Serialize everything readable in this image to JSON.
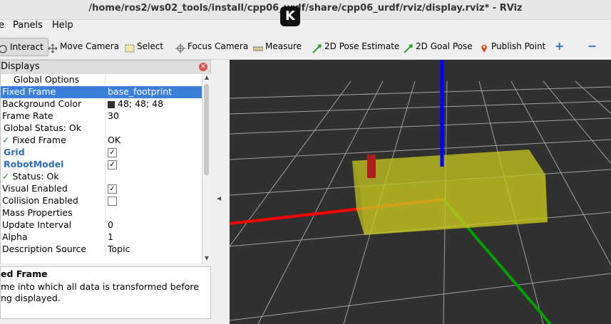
{
  "window": {
    "title": "/home/ros2/ws02_tools/install/cpp06_urdf/share/cpp06_urdf/rviz/display.rviz* - RViz"
  },
  "overlay_logo": "K",
  "menu": {
    "items": [
      "e",
      "Panels",
      "Help"
    ]
  },
  "toolbar": {
    "interact": "Interact",
    "move_camera": "Move Camera",
    "select": "Select",
    "focus_camera": "Focus Camera",
    "measure": "Measure",
    "pose_estimate": "2D Pose Estimate",
    "goal_pose": "2D Goal Pose",
    "publish_point": "Publish Point",
    "plus": "+",
    "minus": "−"
  },
  "displays": {
    "title": "Displays",
    "close": "✕",
    "rows": [
      {
        "key": "Global Options",
        "value": ""
      },
      {
        "key": "Fixed Frame",
        "value": "base_footprint"
      },
      {
        "key": "Background Color",
        "value": "48; 48; 48"
      },
      {
        "key": "Frame Rate",
        "value": "30"
      },
      {
        "key": "Global Status: Ok",
        "value": ""
      },
      {
        "key": "Fixed Frame",
        "value": "OK"
      },
      {
        "key": "Grid",
        "value": "✓"
      },
      {
        "key": "RobotModel",
        "value": "✓"
      },
      {
        "key": "Status: Ok",
        "value": ""
      },
      {
        "key": "Visual Enabled",
        "value": "✓"
      },
      {
        "key": "Collision Enabled",
        "value": ""
      },
      {
        "key": "Mass Properties",
        "value": ""
      },
      {
        "key": "Update Interval",
        "value": "0"
      },
      {
        "key": "Alpha",
        "value": "1"
      },
      {
        "key": "Description Source",
        "value": "Topic"
      }
    ],
    "check_mark": "✓"
  },
  "description": {
    "title": "ed Frame",
    "text": "me into which all data is transformed before ng displayed."
  },
  "colors": {
    "background": "#303030",
    "grid": "#a0a0a4",
    "x_axis": "#ff0000",
    "y_axis": "#00a000",
    "z_axis": "#0000ff",
    "base": "#c8c81e",
    "link": "#b01c1c"
  }
}
